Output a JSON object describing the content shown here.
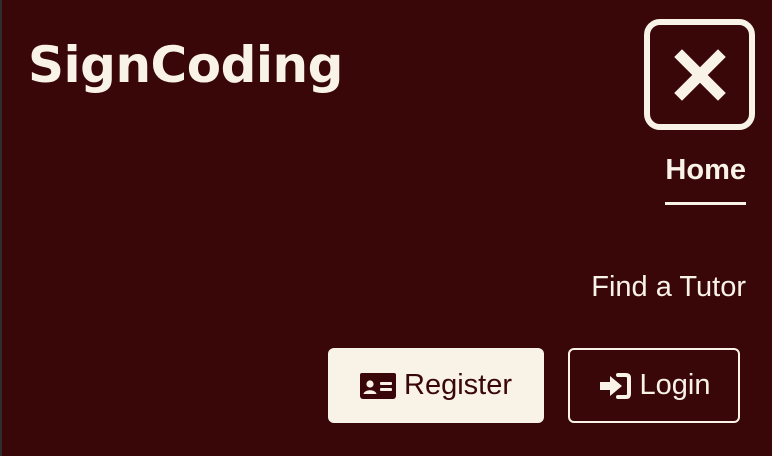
{
  "header": {
    "brand": "SignCoding",
    "close_icon": "close-icon"
  },
  "nav": {
    "home": "Home",
    "find_tutor": "Find a Tutor"
  },
  "actions": {
    "register": {
      "label": "Register",
      "icon": "id-card-icon"
    },
    "login": {
      "label": "Login",
      "icon": "sign-in-icon"
    }
  },
  "colors": {
    "background": "#3a0709",
    "foreground": "#f8f3e6"
  }
}
